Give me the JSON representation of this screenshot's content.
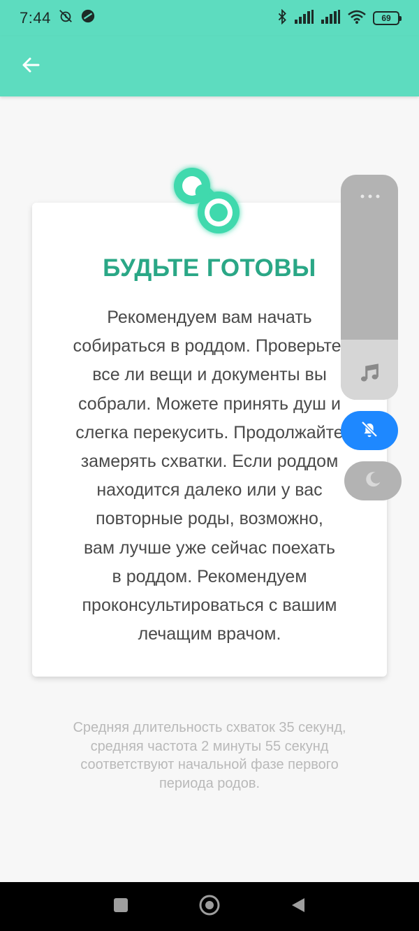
{
  "status_bar": {
    "time": "7:44",
    "battery": "69"
  },
  "card": {
    "title": "БУДЬТЕ ГОТОВЫ",
    "lines": [
      "Рекомендуем вам начать",
      "собираться в роддом. Проверьте,",
      "все ли вещи и документы вы",
      "собрали. Можете принять душ и",
      "слегка перекусить. Продолжайте",
      "замерять схватки. Если роддом",
      "находится далеко или у вас",
      "повторные роды, возможно,",
      "вам лучше уже сейчас поехать",
      "в роддом. Рекомендуем",
      "проконсультироваться с вашим",
      "лечащим врачом."
    ]
  },
  "footer_note": {
    "lines": [
      "Средняя длительность схваток 35 секунд,",
      "средняя частота 2 минуты 55 секунд",
      "соответствуют начальной фазе первого",
      "периода родов."
    ]
  },
  "colors": {
    "accent": "#5ddcbf",
    "title": "#2aa786",
    "mute_button": "#1e88ff"
  },
  "icons": {
    "back": "arrow-left-icon",
    "badge": "pacifier-icon",
    "music": "music-note-icon",
    "mute": "bell-off-icon",
    "moon": "moon-icon",
    "more": "more-dots-icon"
  }
}
